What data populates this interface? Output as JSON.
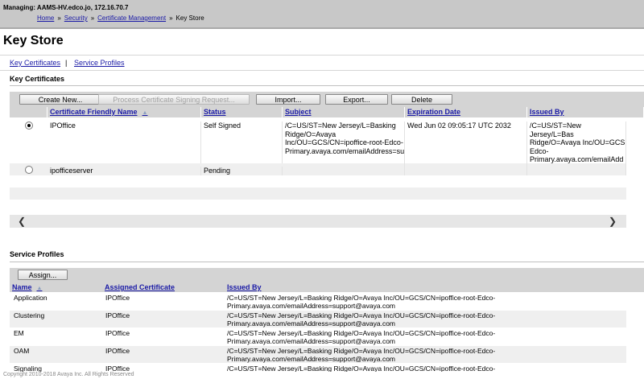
{
  "header": {
    "managing": "Managing: AAMS-HV.edco.jo, 172.16.70.7",
    "breadcrumb": [
      "Home",
      "Security",
      "Certificate Management",
      "Key Store"
    ],
    "separator": "»"
  },
  "page_title": "Key Store",
  "tabs": {
    "key_certificates": "Key Certificates",
    "separator": "|",
    "service_profiles": "Service Profiles"
  },
  "key_certificates": {
    "section_title": "Key Certificates",
    "buttons": {
      "create_new": "Create New...",
      "process_csr": "Process Certificate Signing Request...",
      "import": "Import...",
      "export": "Export...",
      "delete": "Delete"
    },
    "columns": {
      "friendly_name": "Certificate Friendly Name",
      "status": "Status",
      "subject": "Subject",
      "expiration": "Expiration Date",
      "issued_by": "Issued By"
    },
    "sort_indicator": "▲",
    "rows": [
      {
        "selected": true,
        "name": "IPOffice",
        "status": "Self Signed",
        "subject": "/C=US/ST=New Jersey/L=Basking Ridge/O=Avaya Inc/OU=GCS/CN=ipoffice-root-Edco-Primary.avaya.com/emailAddress=su",
        "expiration": "Wed Jun 02 09:05:17 UTC 2032",
        "issued_by": "/C=US/ST=New Jersey/L=Bas Ridge/O=Avaya Inc/OU=GCS Edco-Primary.avaya.com/emailAdd"
      },
      {
        "selected": false,
        "name": "ipofficeserver",
        "status": "Pending",
        "subject": "",
        "expiration": "",
        "issued_by": ""
      }
    ],
    "scroll_left": "❮",
    "scroll_right": "❯"
  },
  "service_profiles": {
    "section_title": "Service Profiles",
    "assign_button": "Assign...",
    "columns": {
      "name": "Name",
      "assigned_certificate": "Assigned Certificate",
      "issued_by": "Issued By"
    },
    "sort_indicator": "▲",
    "rows": [
      {
        "name": "Application",
        "certificate": "IPOffice",
        "issued_by": "/C=US/ST=New Jersey/L=Basking Ridge/O=Avaya Inc/OU=GCS/CN=ipoffice-root-Edco-Primary.avaya.com/emailAddress=support@avaya.com"
      },
      {
        "name": "Clustering",
        "certificate": "IPOffice",
        "issued_by": "/C=US/ST=New Jersey/L=Basking Ridge/O=Avaya Inc/OU=GCS/CN=ipoffice-root-Edco-Primary.avaya.com/emailAddress=support@avaya.com"
      },
      {
        "name": "EM",
        "certificate": "IPOffice",
        "issued_by": "/C=US/ST=New Jersey/L=Basking Ridge/O=Avaya Inc/OU=GCS/CN=ipoffice-root-Edco-Primary.avaya.com/emailAddress=support@avaya.com"
      },
      {
        "name": "OAM",
        "certificate": "IPOffice",
        "issued_by": "/C=US/ST=New Jersey/L=Basking Ridge/O=Avaya Inc/OU=GCS/CN=ipoffice-root-Edco-Primary.avaya.com/emailAddress=support@avaya.com"
      },
      {
        "name": "Signaling",
        "certificate": "IPOffice",
        "issued_by": "/C=US/ST=New Jersey/L=Basking Ridge/O=Avaya Inc/OU=GCS/CN=ipoffice-root-Edco-"
      }
    ]
  },
  "footer": {
    "copyright": "Copyright 2010-2018 Avaya Inc. All Rights Reserved"
  },
  "colors": {
    "header_bg": "#c8c8c8",
    "toolbar_bg": "#d4d4d4",
    "link": "#1a1aa6",
    "stripe": "#efefef"
  }
}
